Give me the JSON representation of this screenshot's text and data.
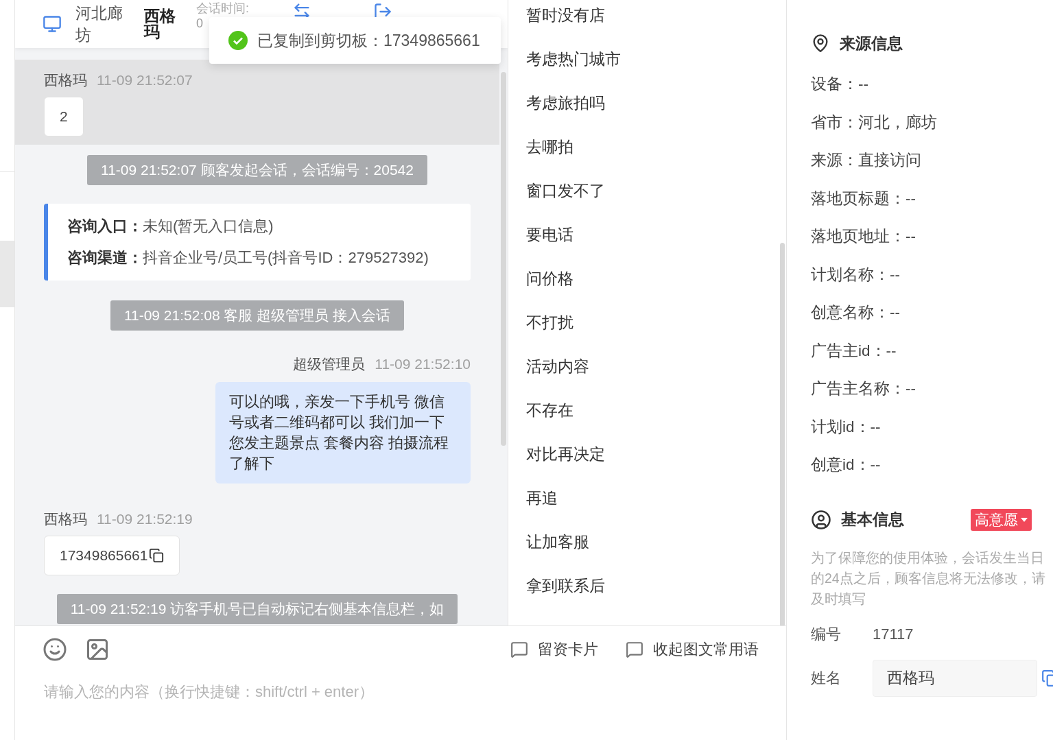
{
  "header": {
    "location": "河北廊坊",
    "customer": "西格玛",
    "session_label": "会话时间:",
    "session_value": "0"
  },
  "toast": {
    "text": "已复制到剪切板：17349865661"
  },
  "messages": [
    {
      "kind": "customer",
      "sender": "西格玛",
      "time": "11-09 21:52:07",
      "text": "2",
      "highlighted": true,
      "copyable": false
    },
    {
      "kind": "system",
      "text": "11-09 21:52:07 顾客发起会话，会话编号：20542"
    },
    {
      "kind": "entry",
      "lines": [
        {
          "label": "咨询入口：",
          "value": "未知(暂无入口信息)"
        },
        {
          "label": "咨询渠道：",
          "value": "抖音企业号/员工号(抖音号ID：279527392)"
        }
      ]
    },
    {
      "kind": "system",
      "text": "11-09 21:52:08 客服 超级管理员 接入会话"
    },
    {
      "kind": "agent",
      "sender": "超级管理员",
      "time": "11-09 21:52:10",
      "text": "可以的哦，亲发一下手机号 微信号或者二维码都可以 我们加一下您发主题景点 套餐内容 拍摄流程了解下"
    },
    {
      "kind": "customer",
      "sender": "西格玛",
      "time": "11-09 21:52:19",
      "text": "17349865661",
      "highlighted": false,
      "copyable": true
    },
    {
      "kind": "system",
      "text": "11-09 21:52:19 访客手机号已自动标记右侧基本信息栏，如"
    }
  ],
  "quick_replies": [
    "暂时没有店",
    "考虑热门城市",
    "考虑旅拍吗",
    "去哪拍",
    "窗口发不了",
    "要电话",
    "问价格",
    "不打扰",
    "活动内容",
    "不存在",
    "对比再决定",
    "再追",
    "让加客服",
    "拿到联系后"
  ],
  "composer": {
    "tools": [
      "留资卡片",
      "收起图文常用语"
    ],
    "placeholder": "请输入您的内容（换行快捷键：shift/ctrl + enter）"
  },
  "source_info": {
    "title": "来源信息",
    "fields": [
      "设备：--",
      "省市：河北，廊坊",
      "来源：直接访问",
      "落地页标题：--",
      "落地页地址：--",
      "计划名称：--",
      "创意名称：--",
      "广告主id：--",
      "广告主名称：--",
      "计划id：--",
      "创意id：--"
    ]
  },
  "basic_info": {
    "title": "基本信息",
    "intent_tag": "高意愿",
    "notice": "为了保障您的使用体验，会话发生当日的24点之后，顾客信息将无法修改，请及时填写",
    "number_label": "编号",
    "number": "17117",
    "name_label": "姓名",
    "name": "西格玛"
  }
}
